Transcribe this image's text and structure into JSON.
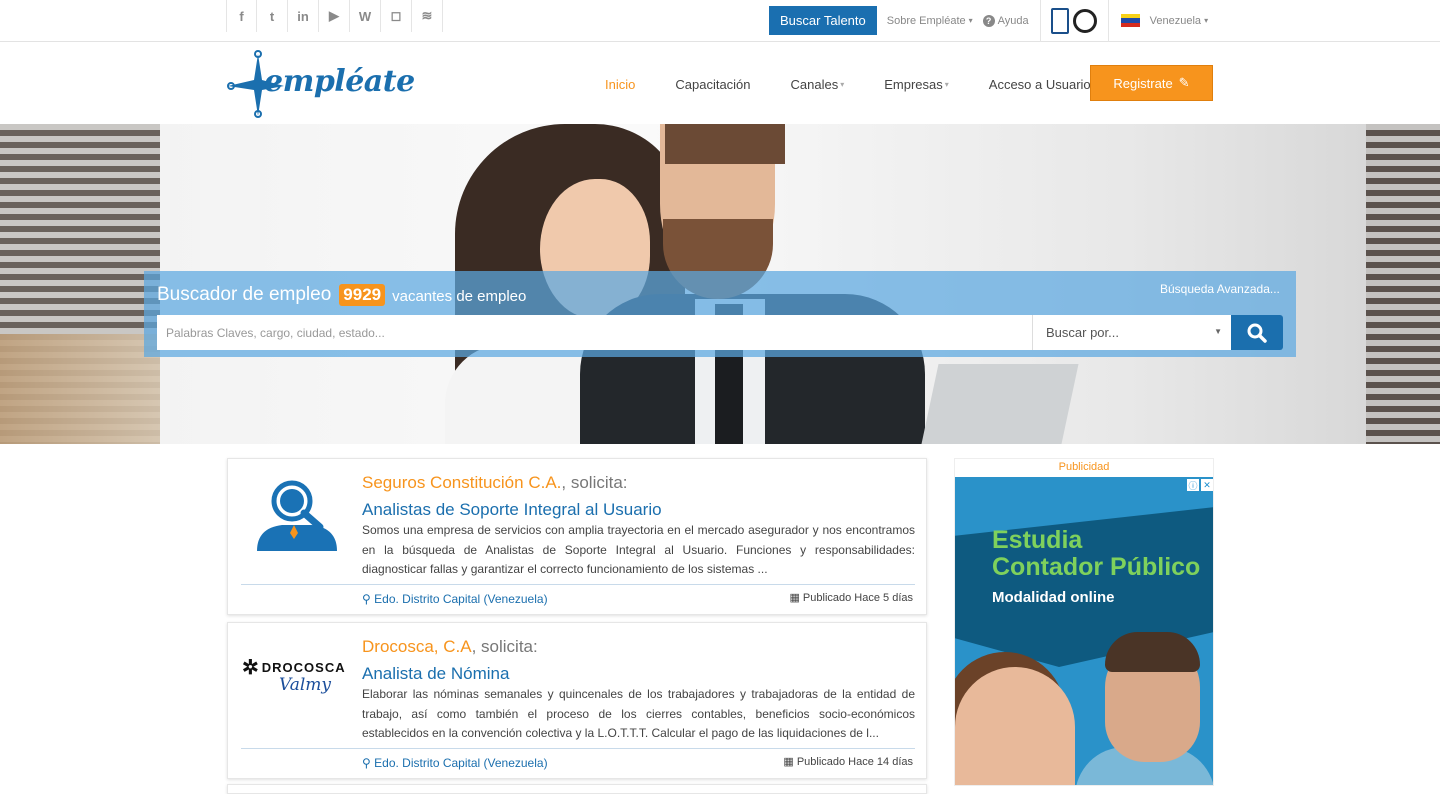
{
  "topbar": {
    "social": [
      {
        "icon": "facebook-icon",
        "glyph": "f"
      },
      {
        "icon": "twitter-icon",
        "glyph": "t"
      },
      {
        "icon": "linkedin-icon",
        "glyph": "in"
      },
      {
        "icon": "youtube-icon",
        "glyph": "▶"
      },
      {
        "icon": "wordpress-icon",
        "glyph": "W"
      },
      {
        "icon": "instagram-icon",
        "glyph": "◻"
      },
      {
        "icon": "rss-icon",
        "glyph": "≋"
      }
    ],
    "buscar_talento": "Buscar Talento",
    "sobre": "Sobre Empléate",
    "ayuda": "Ayuda",
    "country": "Venezuela"
  },
  "header": {
    "logo_text": "empléate",
    "nav": [
      {
        "label": "Inicio",
        "active": true,
        "dropdown": false
      },
      {
        "label": "Capacitación",
        "active": false,
        "dropdown": false
      },
      {
        "label": "Canales",
        "active": false,
        "dropdown": true
      },
      {
        "label": "Empresas",
        "active": false,
        "dropdown": true
      },
      {
        "label": "Acceso a Usuarios",
        "active": false,
        "dropdown": true
      }
    ],
    "register": "Registrate"
  },
  "search": {
    "title": "Buscador de empleo",
    "count": "9929",
    "subtitle": "vacantes de empleo",
    "advanced": "Búsqueda Avanzada...",
    "placeholder": "Palabras Claves, cargo, ciudad, estado...",
    "select_label": "Buscar por..."
  },
  "jobs": [
    {
      "company": "Seguros Constitución C.A.",
      "solicita": ", solicita:",
      "title": "Analistas de Soporte Integral al Usuario",
      "description": "Somos una empresa de servicios con amplia trayectoria en el mercado asegurador y nos encontramos en la búsqueda de Analistas de Soporte Integral al Usuario. Funciones y responsabilidades: diagnosticar fallas y garantizar el correcto funcionamiento de los sistemas ...",
      "location": "Edo. Distrito Capital (Venezuela)",
      "published": "Publicado Hace 5 días"
    },
    {
      "company": "Drocosca, C.A",
      "solicita": ", solicita:",
      "title": "Analista de Nómina",
      "description": "Elaborar las nóminas semanales y quincenales de los trabajadores y trabajadoras de la entidad de trabajo, así como también el proceso de los cierres contables, beneficios socio-económicos establecidos en la convención colectiva y la L.O.T.T.T. Calcular el pago de las liquidaciones de l...",
      "location": "Edo. Distrito Capital (Venezuela)",
      "published": "Publicado Hace 14 días",
      "logo_text": "DROCOSCA",
      "logo_sub": "Valmy"
    }
  ],
  "ad": {
    "label": "Publicidad",
    "headline1": "Estudia",
    "headline2": "Contador Público",
    "sub": "Modalidad online"
  },
  "colors": {
    "accent": "#f7941d",
    "brand": "#1b6fae"
  }
}
